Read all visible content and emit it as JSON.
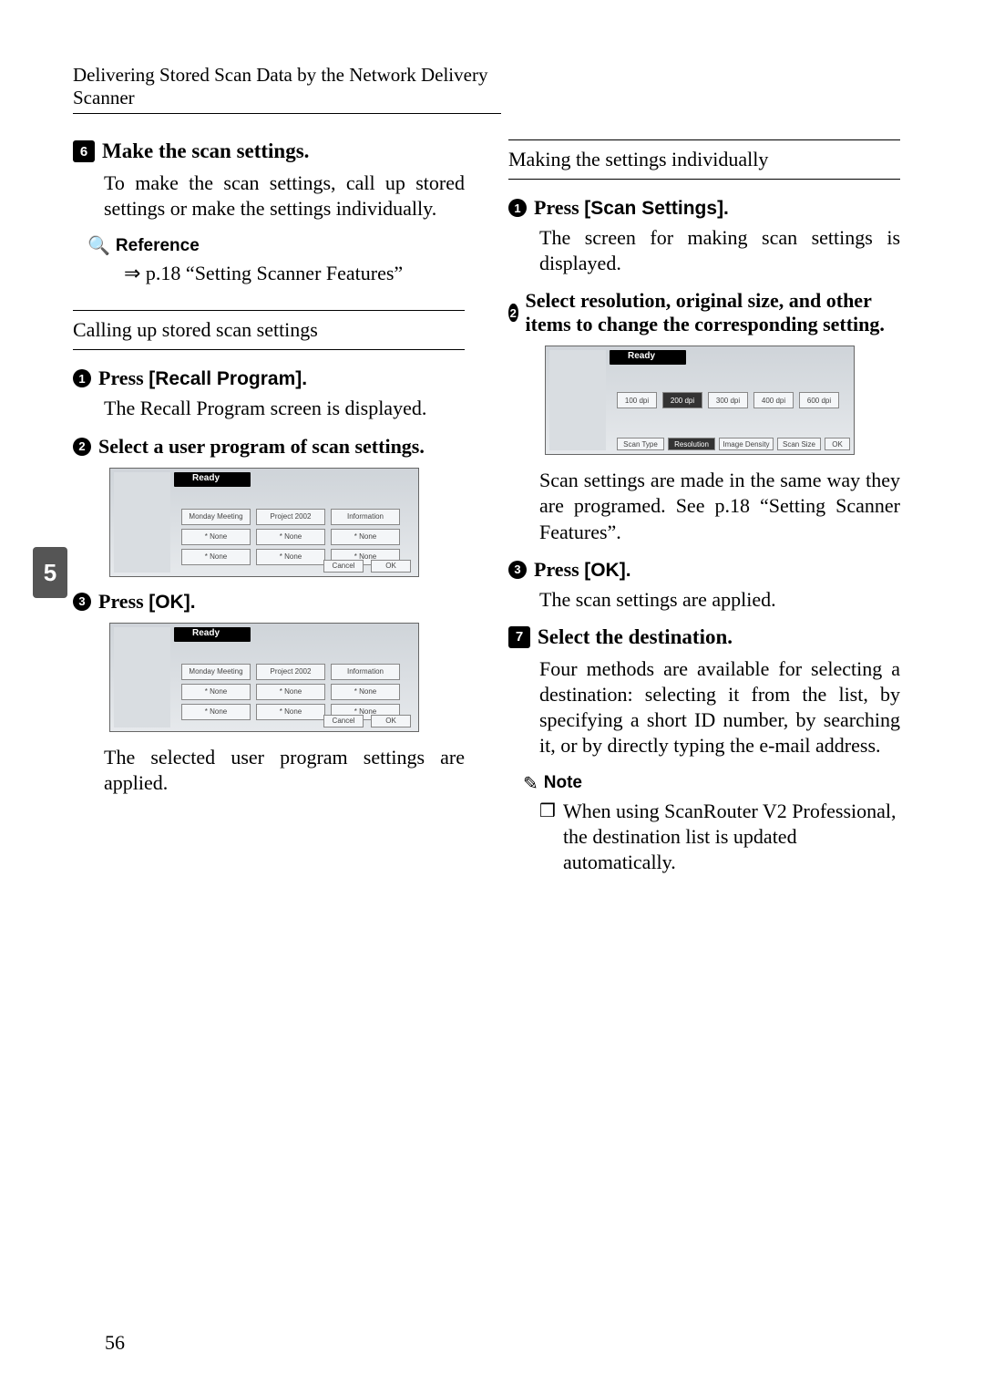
{
  "header": {
    "section_title": "Delivering Stored Scan Data by the Network Delivery Scanner"
  },
  "left": {
    "step6": {
      "num": "6",
      "title": "Make the scan settings.",
      "body": "To make the scan settings, call up stored settings or make the settings individually."
    },
    "reference": {
      "label": "Reference",
      "body": "⇒ p.18 “Setting Scanner Features”"
    },
    "sub_heading": "Calling up stored scan settings",
    "s1": {
      "num": "1",
      "title_pre": "Press ",
      "title_bold": "[Recall Program].",
      "body": "The Recall Program screen is displayed."
    },
    "s2": {
      "num": "2",
      "title": "Select a user program of scan settings."
    },
    "s3": {
      "num": "3",
      "title_pre": "Press ",
      "title_bold": "[OK]."
    },
    "s3_body": "The selected user program settings are applied."
  },
  "right": {
    "sub_heading": "Making the settings individually",
    "s1": {
      "num": "1",
      "title_pre": "Press ",
      "title_bold": "[Scan Settings].",
      "body": "The screen for making scan settings is displayed."
    },
    "s2": {
      "num": "2",
      "title": "Select resolution, original size, and other items to change the corresponding setting.",
      "body": "Scan settings are made in the same way they are programed. See p.18 “Setting Scanner Features”."
    },
    "s3": {
      "num": "3",
      "title_pre": "Press ",
      "title_bold": "[OK].",
      "body": "The scan settings are applied."
    },
    "step7": {
      "num": "7",
      "title": "Select the destination.",
      "body": "Four methods are available for selecting a destination: selecting it from the list, by specifying a short ID number, by searching it, or by directly typing the e-mail address."
    },
    "note": {
      "label": "Note",
      "body": "When using ScanRouter V2 Professional, the destination list is updated automatically."
    }
  },
  "shots": {
    "recall": {
      "items": [
        "Monday Meeting",
        "Project 2002",
        "Information",
        "* None",
        "* None",
        "* None",
        "* None",
        "* None",
        "* None"
      ],
      "cancel": "Cancel",
      "ok": "OK"
    },
    "recall2": {
      "items": [
        "Monday Meeting",
        "Project 2002",
        "Information",
        "* None",
        "* None",
        "* None",
        "* None",
        "* None",
        "* None"
      ],
      "cancel": "Cancel",
      "ok": "OK"
    },
    "scan_res": {
      "dpi": [
        "100 dpi",
        "200 dpi",
        "300 dpi",
        "400 dpi",
        "600 dpi"
      ],
      "tabs": [
        "Scan Type",
        "Resolution",
        "Image Density",
        "Scan Size"
      ],
      "ok": "OK"
    }
  },
  "chapter": "5",
  "page_number": "56"
}
